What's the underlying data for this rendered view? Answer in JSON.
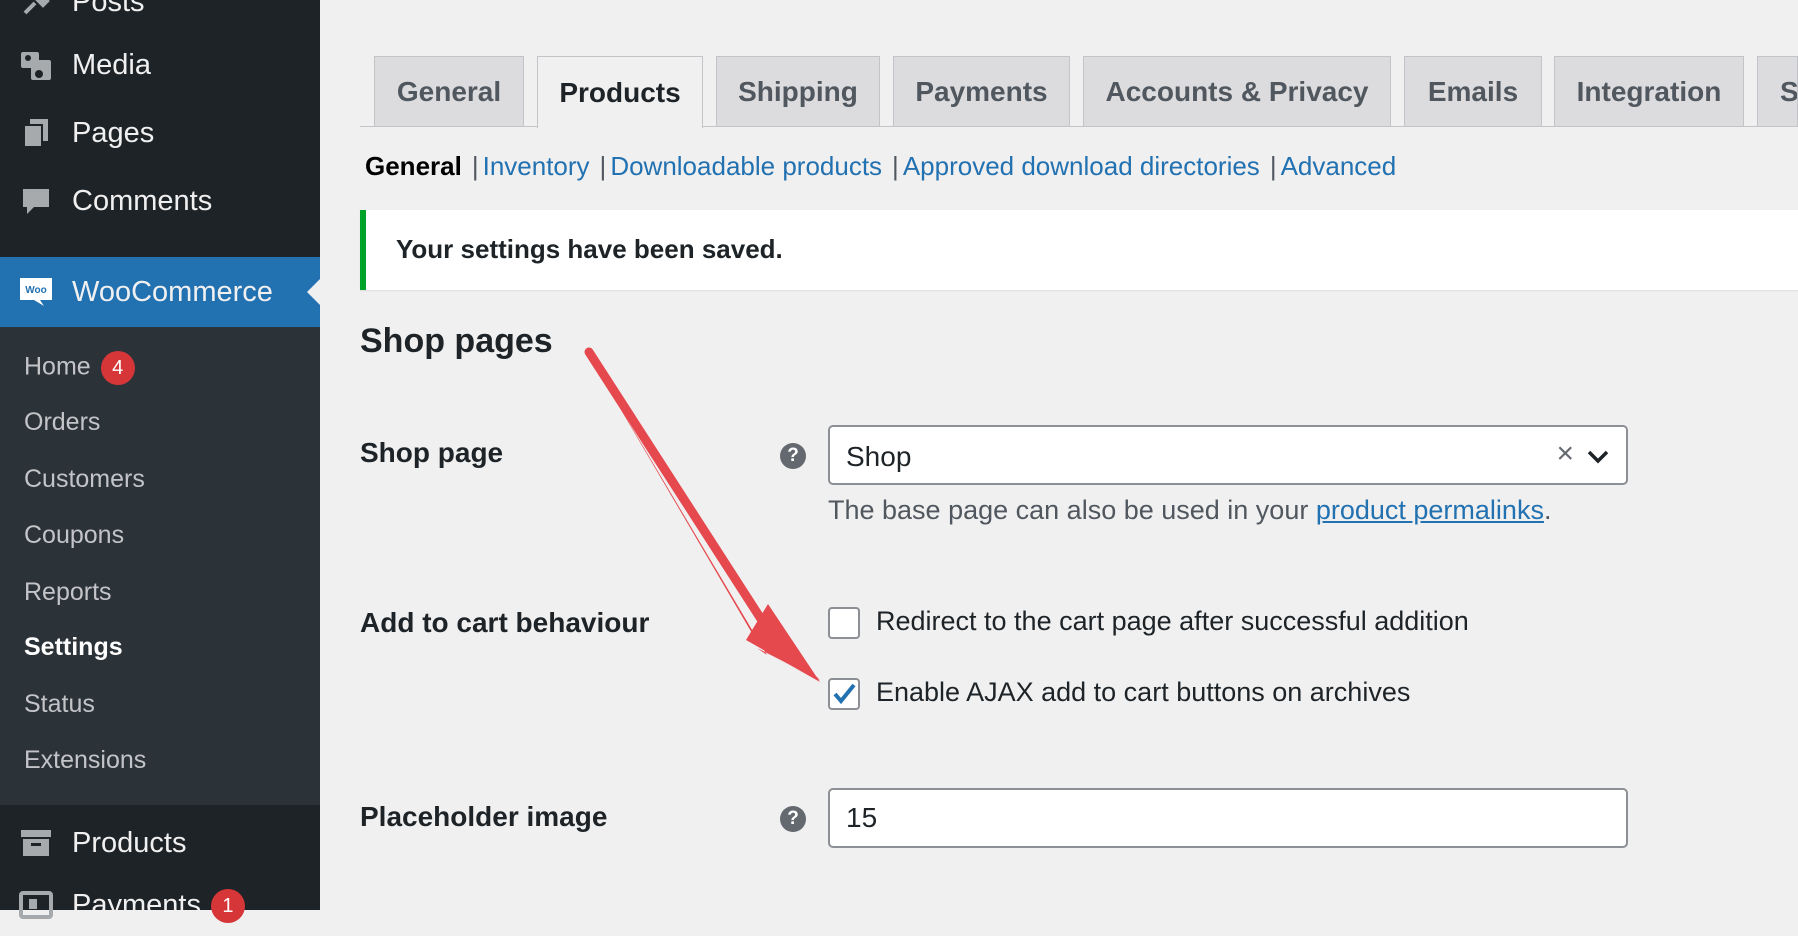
{
  "sidebar": {
    "top_items": [
      {
        "label": "Posts",
        "icon": "pin-icon"
      },
      {
        "label": "Media",
        "icon": "media-icon"
      },
      {
        "label": "Pages",
        "icon": "pages-icon"
      },
      {
        "label": "Comments",
        "icon": "comment-icon"
      }
    ],
    "woocommerce": {
      "label": "WooCommerce",
      "icon_text": "Woo"
    },
    "submenu": [
      {
        "label": "Home",
        "badge": "4"
      },
      {
        "label": "Orders"
      },
      {
        "label": "Customers"
      },
      {
        "label": "Coupons"
      },
      {
        "label": "Reports"
      },
      {
        "label": "Settings",
        "current": true
      },
      {
        "label": "Status"
      },
      {
        "label": "Extensions"
      }
    ],
    "bottom_items": [
      {
        "label": "Products",
        "icon": "archive-icon"
      },
      {
        "label": "Payments",
        "badge": "1",
        "icon": "payments-icon"
      }
    ]
  },
  "tabs": [
    {
      "label": "General"
    },
    {
      "label": "Products",
      "active": true
    },
    {
      "label": "Shipping"
    },
    {
      "label": "Payments"
    },
    {
      "label": "Accounts & Privacy"
    },
    {
      "label": "Emails"
    },
    {
      "label": "Integration"
    },
    {
      "label": "S"
    }
  ],
  "subnav": {
    "current": "General",
    "links": [
      "Inventory",
      "Downloadable products",
      "Approved download directories",
      "Advanced"
    ],
    "separator": "|"
  },
  "notice": {
    "text": "Your settings have been saved.",
    "color": "#00a32a"
  },
  "section": {
    "title": "Shop pages"
  },
  "fields": {
    "shop_page": {
      "label": "Shop page",
      "value": "Shop",
      "clear_glyph": "×",
      "desc_before": "The base page can also be used in your ",
      "desc_link": "product permalinks",
      "desc_after": "."
    },
    "add_to_cart": {
      "label": "Add to cart behaviour",
      "options": [
        {
          "label": "Redirect to the cart page after successful addition",
          "checked": false
        },
        {
          "label": "Enable AJAX add to cart buttons on archives",
          "checked": true
        }
      ]
    },
    "placeholder_image": {
      "label": "Placeholder image",
      "value": "15"
    }
  },
  "help_glyph": "?",
  "colors": {
    "accent": "#2271b1",
    "sidebar": "#1d2327",
    "arrow": "#e5484d",
    "badge": "#d63638"
  }
}
